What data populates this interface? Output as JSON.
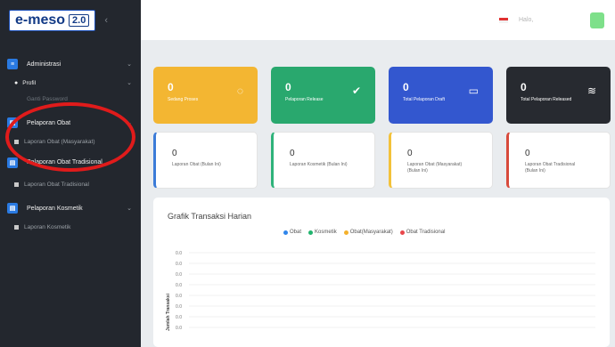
{
  "brand": {
    "name": "e-meso",
    "version": "2.0",
    "collapse_icon": "chevron-left-icon"
  },
  "sidebar": {
    "sections": [
      {
        "label": "Administrasi",
        "icon": "admin-icon"
      },
      {
        "label": "Pelaporan Obat",
        "icon": "report-icon"
      },
      {
        "label": "Pelaporan Obat Tradisional",
        "icon": "report-icon"
      },
      {
        "label": "Pelaporan Kosmetik",
        "icon": "report-icon"
      }
    ],
    "subs": {
      "profil": "Profil",
      "ganti_password": "Ganti Password",
      "laporan_obat": "Laporan Obat (Masyarakat)",
      "laporan_tradisional": "Laporan Obat Tradisional",
      "laporan_kosmetik": "Laporan Kosmetik"
    }
  },
  "topbar": {
    "greeting": "Halo,"
  },
  "stats": [
    {
      "value": "0",
      "label": "Sedang Proses",
      "icon": "spinner-icon",
      "color": "#f3b632"
    },
    {
      "value": "0",
      "label": "Pelaporan Release",
      "icon": "check-icon",
      "color": "#29a86e"
    },
    {
      "value": "0",
      "label": "Total Pelaporan Draft",
      "icon": "inbox-icon",
      "color": "#3357cf"
    },
    {
      "value": "0",
      "label": "Total Pelaporan Released",
      "icon": "layers-icon",
      "color": "#272a30"
    }
  ],
  "reports": [
    {
      "value": "0",
      "label": "Laporan Obat (Bulan Ini)"
    },
    {
      "value": "0",
      "label": "Laporan Kosmetik (Bulan Ini)"
    },
    {
      "value": "0",
      "label": "Laporan Obat (Masyarakat) (Bulan Ini)"
    },
    {
      "value": "0",
      "label": "Laporan Obat Tradisional (Bulan Ini)"
    }
  ],
  "chart": {
    "title": "Grafik Transaksi Harian",
    "legend": [
      {
        "name": "Obat",
        "color": "#2f86eb"
      },
      {
        "name": "Kosmetik",
        "color": "#21b46e"
      },
      {
        "name": "Obat(Masyarakat)",
        "color": "#f4b12c"
      },
      {
        "name": "Obat Tradisional",
        "color": "#e8474b"
      }
    ]
  },
  "chart_data": {
    "type": "line",
    "title": "Grafik Transaksi Harian",
    "ylabel": "Jumlah Transaksi",
    "yticks": [
      "0.0",
      "0.0",
      "0.0",
      "0.0",
      "0.0",
      "0.0",
      "0.0",
      "0.0"
    ],
    "series": [
      {
        "name": "Obat",
        "values": []
      },
      {
        "name": "Kosmetik",
        "values": []
      },
      {
        "name": "Obat(Masyarakat)",
        "values": []
      },
      {
        "name": "Obat Tradisional",
        "values": []
      }
    ],
    "grid": true
  }
}
